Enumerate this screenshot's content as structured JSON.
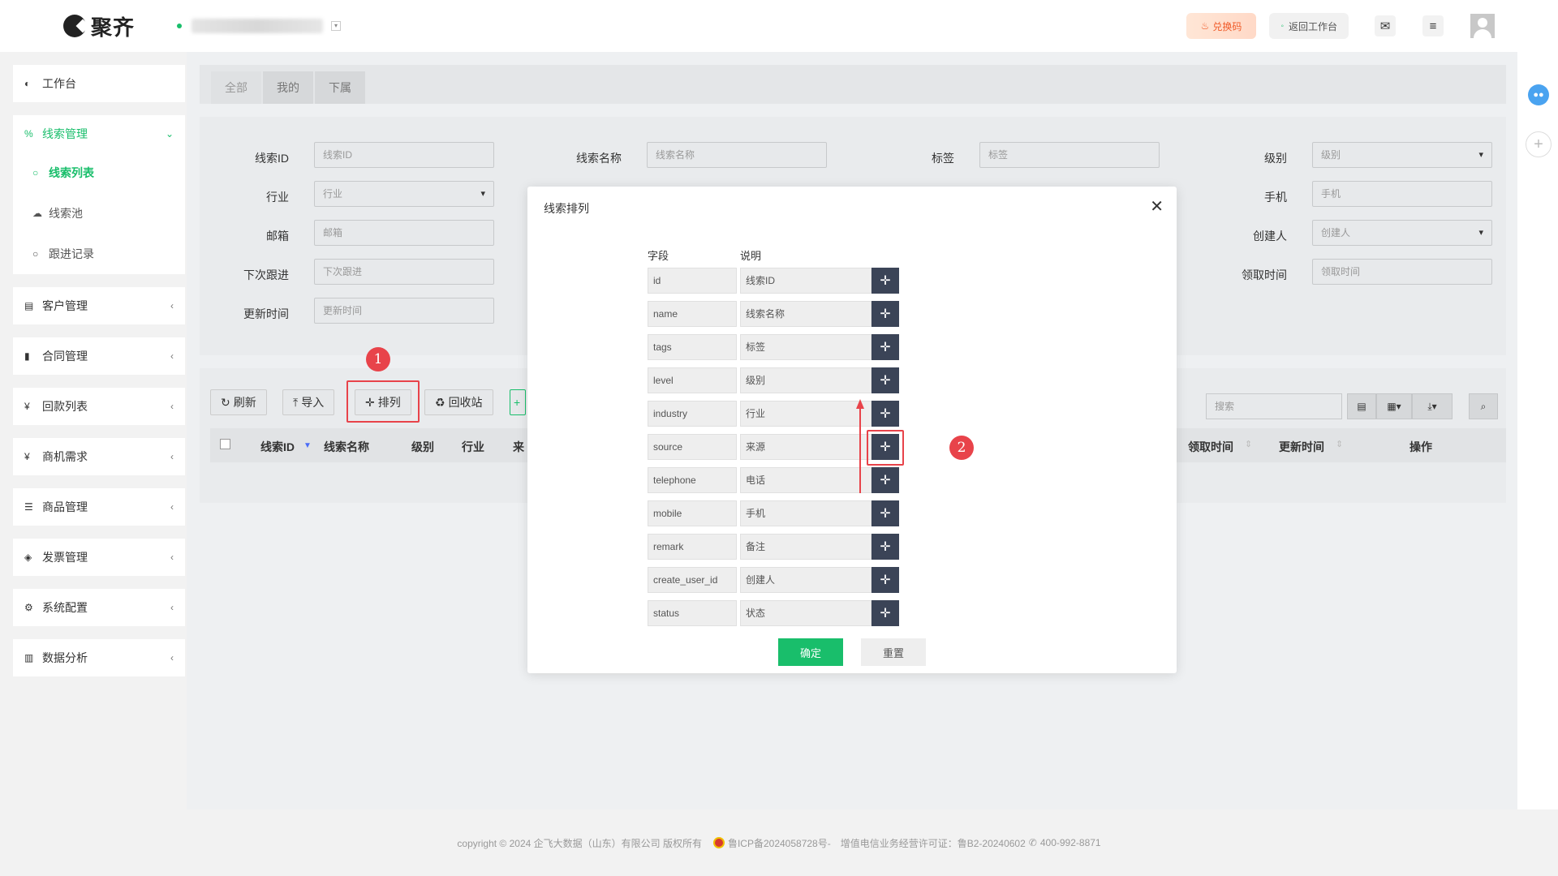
{
  "header": {
    "logo_text": "聚齐",
    "redeem_label": "兑换码",
    "back_label": "返回工作台"
  },
  "sidebar": {
    "items": [
      {
        "label": "工作台",
        "icon": "dashboard-icon",
        "glyph": "◐"
      },
      {
        "label": "线索管理",
        "icon": "clue-icon",
        "glyph": "%"
      },
      {
        "label": "客户管理",
        "icon": "customer-card-icon",
        "glyph": "▤"
      },
      {
        "label": "合同管理",
        "icon": "bookmark-icon",
        "glyph": "▮"
      },
      {
        "label": "回款列表",
        "icon": "yen-icon",
        "glyph": "¥"
      },
      {
        "label": "商机需求",
        "icon": "yen-icon",
        "glyph": "¥"
      },
      {
        "label": "商品管理",
        "icon": "list-icon",
        "glyph": "☰"
      },
      {
        "label": "发票管理",
        "icon": "tag-icon",
        "glyph": "◈"
      },
      {
        "label": "系统配置",
        "icon": "gears-icon",
        "glyph": "⚙"
      },
      {
        "label": "数据分析",
        "icon": "bar-chart-icon",
        "glyph": "▥"
      }
    ],
    "sub_items": [
      {
        "label": "线索列表",
        "glyph": "○"
      },
      {
        "label": "线索池",
        "glyph": "☁"
      },
      {
        "label": "跟进记录",
        "glyph": "○"
      }
    ]
  },
  "tabs": [
    "全部",
    "我的",
    "下属"
  ],
  "filters": {
    "labels": [
      "线索ID",
      "线索名称",
      "标签",
      "级别",
      "行业",
      "手机",
      "邮箱",
      "创建人",
      "下次跟进",
      "领取时间",
      "更新时间"
    ],
    "placeholders": [
      "线索ID",
      "线索名称",
      "标签",
      "级别",
      "行业",
      "手机",
      "邮箱",
      "创建人",
      "下次跟进",
      "领取时间",
      "更新时间"
    ]
  },
  "toolbar": {
    "refresh": "刷新",
    "import": "导入",
    "arrange": "排列",
    "recycle": "回收站",
    "search_placeholder": "搜索"
  },
  "table": {
    "headers_left": [
      "线索ID",
      "线索名称",
      "级别",
      "行业",
      "来"
    ],
    "headers_right": [
      "领取时间",
      "更新时间",
      "操作"
    ]
  },
  "modal": {
    "title": "线索排列",
    "col_field": "字段",
    "col_desc": "说明",
    "rows": [
      {
        "field": "id",
        "desc": "线索ID"
      },
      {
        "field": "name",
        "desc": "线索名称"
      },
      {
        "field": "tags",
        "desc": "标签"
      },
      {
        "field": "level",
        "desc": "级别"
      },
      {
        "field": "industry",
        "desc": "行业"
      },
      {
        "field": "source",
        "desc": "来源"
      },
      {
        "field": "telephone",
        "desc": "电话"
      },
      {
        "field": "mobile",
        "desc": "手机"
      },
      {
        "field": "remark",
        "desc": "备注"
      },
      {
        "field": "create_user_id",
        "desc": "创建人"
      },
      {
        "field": "status",
        "desc": "状态"
      }
    ],
    "confirm": "确定",
    "reset": "重置"
  },
  "annotations": {
    "step1": "1",
    "step2": "2"
  },
  "footer": {
    "copyright": "copyright © 2024 企飞大数据（山东）有限公司 版权所有",
    "icp": "鲁ICP备2024058728号-",
    "license": "增值电信业务经营许可证：鲁B2-20240602",
    "phone": "400-992-8871"
  },
  "colors": {
    "accent": "#19be6b",
    "highlight": "#e8434a",
    "move_button": "#3b4457"
  }
}
